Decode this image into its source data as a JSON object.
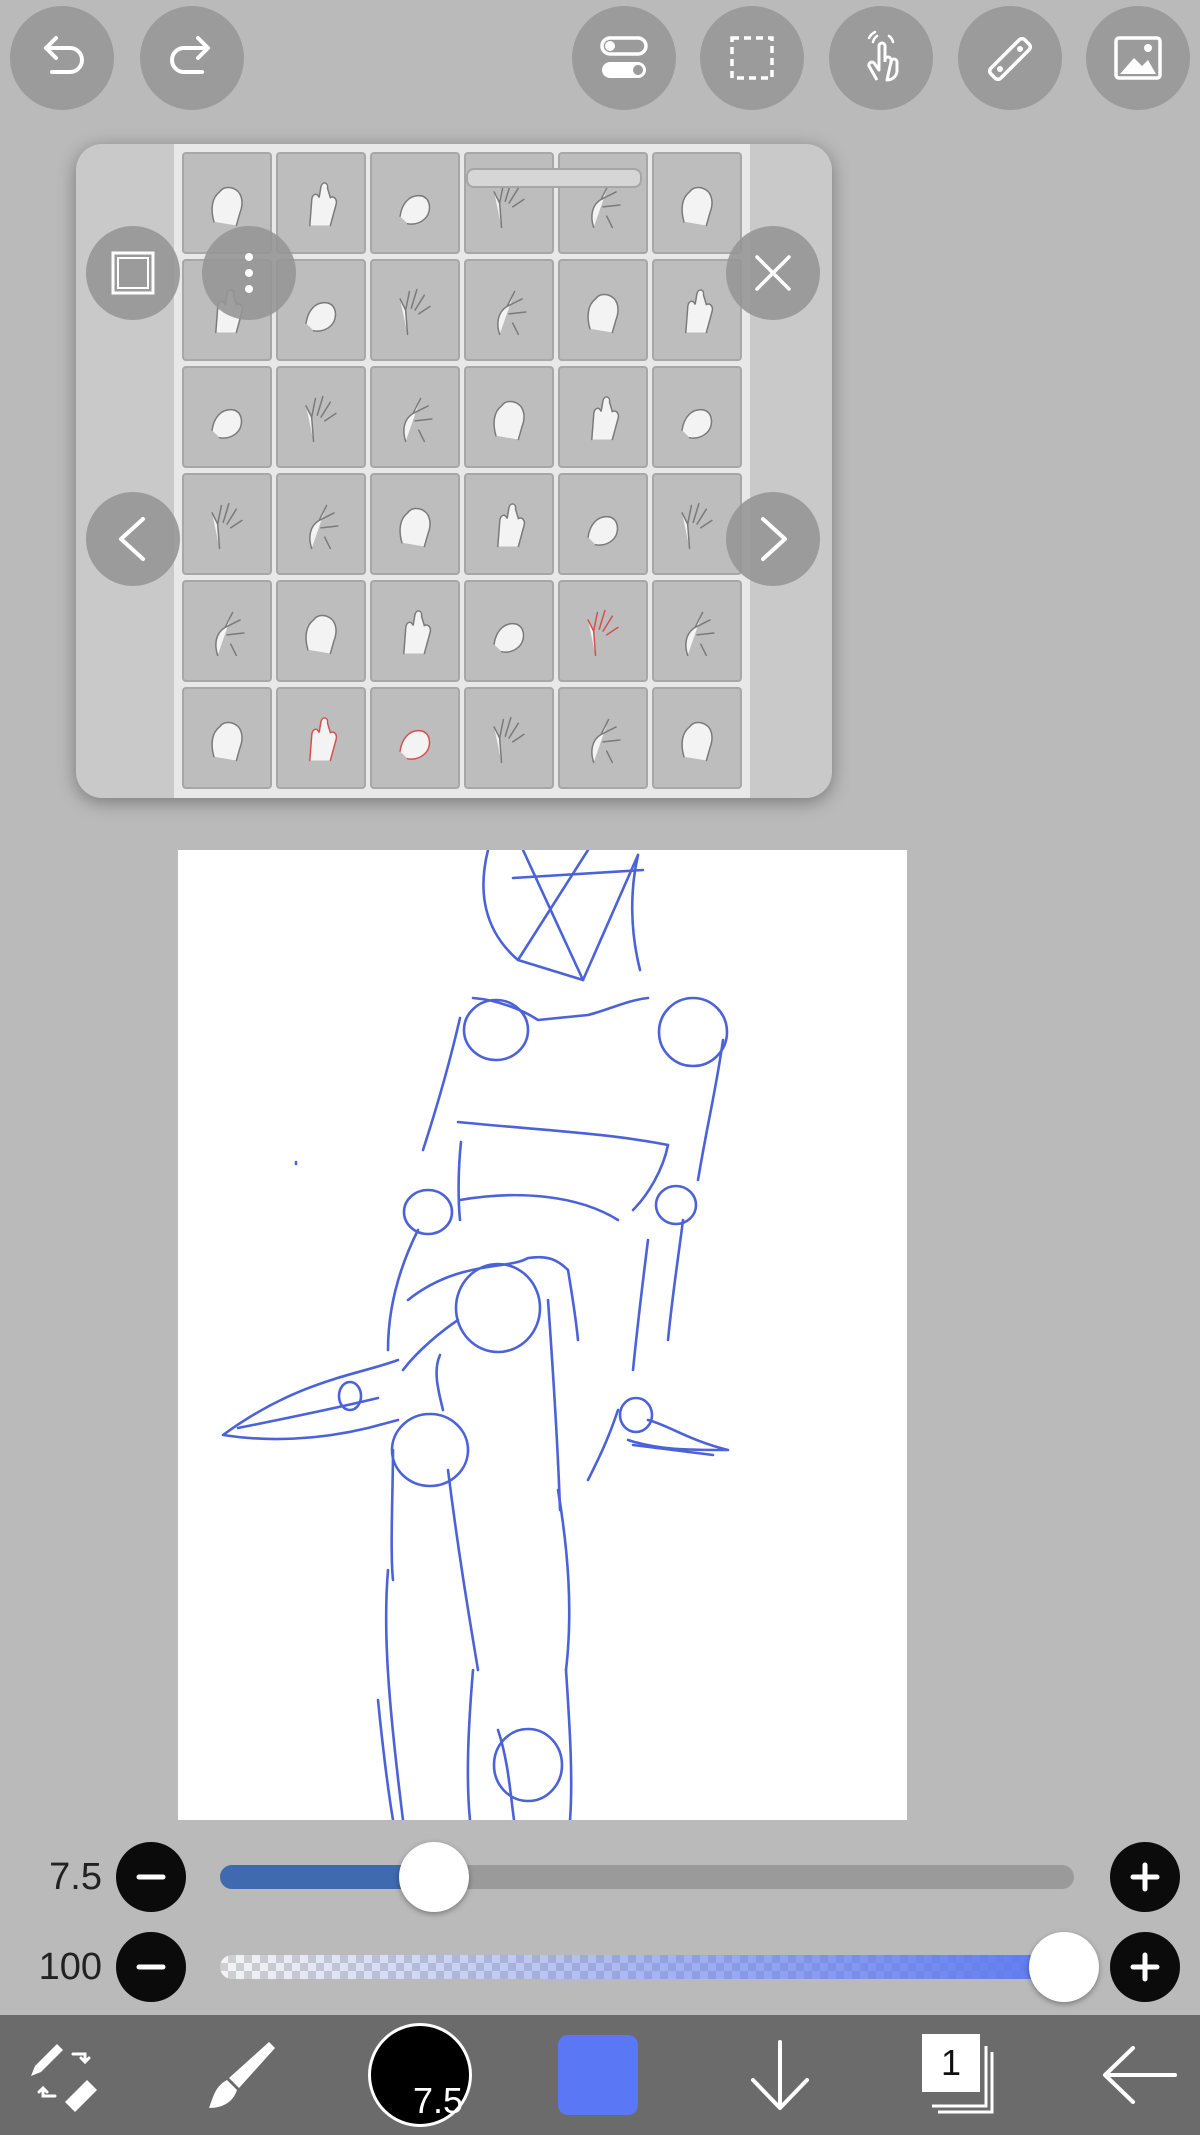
{
  "top_toolbar": {
    "undo_icon": "undo-icon",
    "redo_icon": "redo-icon",
    "toggle_icon": "toggle-settings-icon",
    "selection_icon": "selection-icon",
    "gesture_icon": "gesture-icon",
    "ruler_icon": "ruler-icon",
    "image_icon": "image-icon"
  },
  "reference_panel": {
    "rows": 6,
    "columns": 6,
    "red_cells": [
      28,
      31,
      32
    ],
    "more_label": "•••"
  },
  "sliders": {
    "brush_size_label": "7.5",
    "brush_size_fraction": 0.25,
    "opacity_label": "100",
    "opacity_fraction": 1.0
  },
  "bottom_toolbar": {
    "brush_size_label": "7.5",
    "color": "#5a78f5",
    "layer_count": "1"
  },
  "colors": {
    "background": "#bababa",
    "accent": "#3f6ab0",
    "sketch_stroke": "#4b62d8"
  }
}
